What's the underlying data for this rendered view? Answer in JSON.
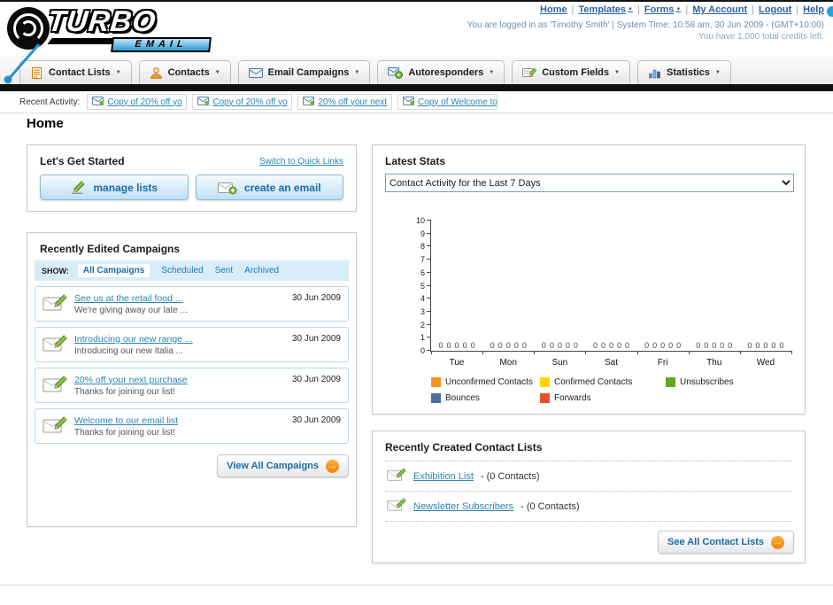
{
  "header": {
    "logo_line1": "TURBO",
    "logo_line2": "EMAIL",
    "top_links": [
      {
        "label": "Home",
        "caret": false
      },
      {
        "label": "Templates",
        "caret": true
      },
      {
        "label": "Forms",
        "caret": true
      },
      {
        "label": "My Account",
        "caret": false
      },
      {
        "label": "Logout",
        "caret": false
      },
      {
        "label": "Help",
        "caret": false
      }
    ],
    "login_info": "You are logged in as 'Timothy Smith' | System Time: 10:58 am, 30 Jun 2009 - (GMT+10:00)",
    "credits_info": "You have 1,000 total credits left."
  },
  "main_nav": {
    "tabs": [
      {
        "label": "Contact Lists",
        "icon": "contact-lists-icon"
      },
      {
        "label": "Contacts",
        "icon": "contacts-icon"
      },
      {
        "label": "Email Campaigns",
        "icon": "email-campaigns-icon"
      },
      {
        "label": "Autoresponders",
        "icon": "autoresponders-icon"
      },
      {
        "label": "Custom Fields",
        "icon": "custom-fields-icon"
      },
      {
        "label": "Statistics",
        "icon": "statistics-icon"
      }
    ]
  },
  "recent_activity": {
    "label": "Recent Activity:",
    "items": [
      {
        "label": "Copy of 20% off yo",
        "icon": "envelope-icon"
      },
      {
        "label": "Copy of 20% off yo",
        "icon": "envelope-icon"
      },
      {
        "label": "20% off your next",
        "icon": "envelope-icon"
      },
      {
        "label": "Copy of Welcome to",
        "icon": "envelope-icon"
      }
    ]
  },
  "page_title": "Home",
  "get_started": {
    "title": "Let's Get Started",
    "switch_link": "Switch to Quick Links",
    "manage_lists_label": "manage lists",
    "create_email_label": "create an email"
  },
  "campaigns": {
    "title": "Recently Edited Campaigns",
    "show_label": "SHOW:",
    "filters": [
      {
        "label": "All Campaigns",
        "selected": true
      },
      {
        "label": "Scheduled",
        "selected": false
      },
      {
        "label": "Sent",
        "selected": false
      },
      {
        "label": "Archived",
        "selected": false
      }
    ],
    "items": [
      {
        "title": "See us at the retail food ...",
        "subtitle": "We're giving away our late ...",
        "date": "30 Jun 2009"
      },
      {
        "title": "Introducing our new range ...",
        "subtitle": "Introducing our new Italia ...",
        "date": "30 Jun 2009"
      },
      {
        "title": "20% off your next purchase",
        "subtitle": "Thanks for joining our list!",
        "date": "30 Jun 2009"
      },
      {
        "title": "Welcome to our email list",
        "subtitle": "Thanks for joining our list!",
        "date": "30 Jun 2009"
      }
    ],
    "view_all_label": "View All Campaigns"
  },
  "stats": {
    "title": "Latest Stats",
    "selected_option": "Contact Activity for the Last 7 Days"
  },
  "chart_data": {
    "type": "bar",
    "title": "Contact Activity for the Last 7 Days",
    "categories": [
      "Tue",
      "Mon",
      "Sun",
      "Sat",
      "Fri",
      "Thu",
      "Wed"
    ],
    "series": [
      {
        "name": "Unconfirmed Contacts",
        "color": "#f7941d",
        "values": [
          0,
          0,
          0,
          0,
          0,
          0,
          0
        ]
      },
      {
        "name": "Confirmed Contacts",
        "color": "#ffd400",
        "values": [
          0,
          0,
          0,
          0,
          0,
          0,
          0
        ]
      },
      {
        "name": "Unsubscribes",
        "color": "#67a61f",
        "values": [
          0,
          0,
          0,
          0,
          0,
          0,
          0
        ]
      },
      {
        "name": "Bounces",
        "color": "#4e6d9e",
        "values": [
          0,
          0,
          0,
          0,
          0,
          0,
          0
        ]
      },
      {
        "name": "Forwards",
        "color": "#e8532c",
        "values": [
          0,
          0,
          0,
          0,
          0,
          0,
          0
        ]
      }
    ],
    "ylim": [
      0,
      10
    ],
    "y_ticks": [
      0,
      1,
      2,
      3,
      4,
      5,
      6,
      7,
      8,
      9,
      10
    ],
    "grid": false,
    "legend_position": "bottom"
  },
  "contact_lists": {
    "title": "Recently Created Contact Lists",
    "items": [
      {
        "name": "Exhibition List",
        "detail": "- (0 Contacts)"
      },
      {
        "name": "Newsletter Subscribers",
        "detail": "- (0 Contacts)"
      }
    ],
    "see_all_label": "See All Contact Lists"
  },
  "colors": {
    "link_teal": "#2a85b5",
    "button_blue_text": "#1a6ca8",
    "accent_orange": "#f7941d",
    "nav_divider": "#101010",
    "filter_bar_bg": "#d9ecfa",
    "panel_border": "#c9c9c9"
  }
}
